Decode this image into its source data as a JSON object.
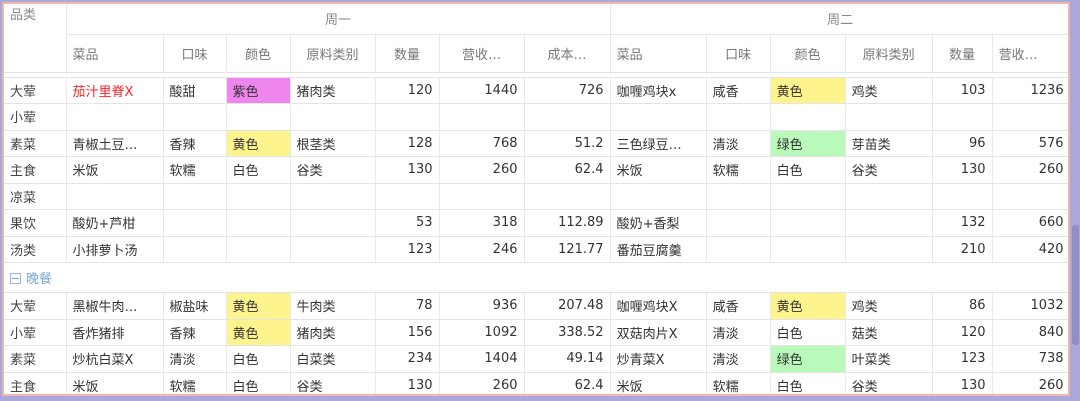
{
  "header": {
    "category_label": "品类",
    "day1": "周一",
    "day2": "周二",
    "columns_day1": [
      "菜品",
      "口味",
      "颜色",
      "原料类别",
      "数量",
      "营收…",
      "成本…"
    ],
    "columns_day2": [
      "菜品",
      "口味",
      "颜色",
      "原料类别",
      "数量",
      "营收…"
    ]
  },
  "colors": {
    "purple": "#ef86ee",
    "yellow": "#fdf48e",
    "green": "#b9f9b9",
    "highlight_text": "#ff2222",
    "frame_border": "#f0b8ad",
    "background": "#a9a8d8"
  },
  "rows_a": [
    {
      "cat": "大荤",
      "d1": {
        "dish": "茄汁里脊X",
        "taste": "酸甜",
        "color": "紫色",
        "material": "猪肉类",
        "qty": "120",
        "rev": "1440",
        "cost": "726"
      },
      "d2": {
        "dish": "咖喱鸡块x",
        "taste": "咸香",
        "color": "黄色",
        "material": "鸡类",
        "qty": "103",
        "rev": "1236"
      }
    },
    {
      "cat": "小荤",
      "d1": {
        "dish": "",
        "taste": "",
        "color": "",
        "material": "",
        "qty": "",
        "rev": "",
        "cost": ""
      },
      "d2": {
        "dish": "",
        "taste": "",
        "color": "",
        "material": "",
        "qty": "",
        "rev": ""
      }
    },
    {
      "cat": "素菜",
      "d1": {
        "dish": "青椒土豆…",
        "taste": "香辣",
        "color": "黄色",
        "material": "根茎类",
        "qty": "128",
        "rev": "768",
        "cost": "51.2"
      },
      "d2": {
        "dish": "三色绿豆…",
        "taste": "清淡",
        "color": "绿色",
        "material": "芽苗类",
        "qty": "96",
        "rev": "576"
      }
    },
    {
      "cat": "主食",
      "d1": {
        "dish": "米饭",
        "taste": "软糯",
        "color": "白色",
        "material": "谷类",
        "qty": "130",
        "rev": "260",
        "cost": "62.4"
      },
      "d2": {
        "dish": "米饭",
        "taste": "软糯",
        "color": "白色",
        "material": "谷类",
        "qty": "130",
        "rev": "260"
      }
    },
    {
      "cat": "凉菜",
      "d1": {
        "dish": "",
        "taste": "",
        "color": "",
        "material": "",
        "qty": "",
        "rev": "",
        "cost": ""
      },
      "d2": {
        "dish": "",
        "taste": "",
        "color": "",
        "material": "",
        "qty": "",
        "rev": ""
      }
    },
    {
      "cat": "果饮",
      "d1": {
        "dish": "酸奶+芦柑",
        "taste": "",
        "color": "",
        "material": "",
        "qty": "53",
        "rev": "318",
        "cost": "112.89"
      },
      "d2": {
        "dish": "酸奶+香梨",
        "taste": "",
        "color": "",
        "material": "",
        "qty": "132",
        "rev": "660"
      }
    },
    {
      "cat": "汤类",
      "d1": {
        "dish": "小排萝卜汤",
        "taste": "",
        "color": "",
        "material": "",
        "qty": "123",
        "rev": "246",
        "cost": "121.77"
      },
      "d2": {
        "dish": "番茄豆腐羹",
        "taste": "",
        "color": "",
        "material": "",
        "qty": "210",
        "rev": "420"
      }
    }
  ],
  "group": {
    "label": "晚餐"
  },
  "rows_b": [
    {
      "cat": "大荤",
      "d1": {
        "dish": "黑椒牛肉…",
        "taste": "椒盐味",
        "color": "黄色",
        "material": "牛肉类",
        "qty": "78",
        "rev": "936",
        "cost": "207.48"
      },
      "d2": {
        "dish": "咖喱鸡块X",
        "taste": "咸香",
        "color": "黄色",
        "material": "鸡类",
        "qty": "86",
        "rev": "1032"
      }
    },
    {
      "cat": "小荤",
      "d1": {
        "dish": "香炸猪排",
        "taste": "香辣",
        "color": "黄色",
        "material": "猪肉类",
        "qty": "156",
        "rev": "1092",
        "cost": "338.52"
      },
      "d2": {
        "dish": "双菇肉片X",
        "taste": "清淡",
        "color": "白色",
        "material": "菇类",
        "qty": "120",
        "rev": "840"
      }
    },
    {
      "cat": "素菜",
      "d1": {
        "dish": "炒杭白菜X",
        "taste": "清淡",
        "color": "白色",
        "material": "白菜类",
        "qty": "234",
        "rev": "1404",
        "cost": "49.14"
      },
      "d2": {
        "dish": "炒青菜X",
        "taste": "清淡",
        "color": "绿色",
        "material": "叶菜类",
        "qty": "123",
        "rev": "738"
      }
    },
    {
      "cat": "主食",
      "d1": {
        "dish": "米饭",
        "taste": "软糯",
        "color": "白色",
        "material": "谷类",
        "qty": "130",
        "rev": "260",
        "cost": "62.4"
      },
      "d2": {
        "dish": "米饭",
        "taste": "软糯",
        "color": "白色",
        "material": "谷类",
        "qty": "130",
        "rev": "260"
      }
    }
  ]
}
